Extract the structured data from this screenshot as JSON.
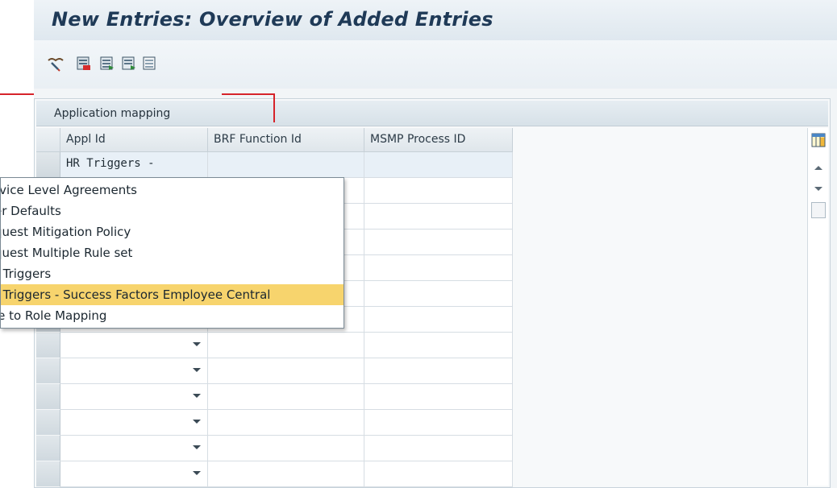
{
  "title": "New Entries: Overview of Added Entries",
  "toolbar": {
    "icons": [
      "edit-glasses-icon",
      "save-variant-icon",
      "select-all-icon",
      "select-block-icon",
      "deselect-all-icon"
    ]
  },
  "panel": {
    "title": "Application mapping"
  },
  "table": {
    "columns": [
      "Appl Id",
      "BRF Function Id",
      "MSMP Process ID"
    ],
    "first_row": {
      "appl_id_value": "HR Triggers -",
      "brf_function_id": "",
      "msmp_process_id": ""
    }
  },
  "dropdown": {
    "items": [
      "rvice Level Agreements",
      "er Defaults",
      "quest Mitigation Policy",
      "quest Multiple Rule set",
      "( Triggers",
      "( Triggers - Success Factors Employee Central",
      "le to Role Mapping"
    ],
    "highlighted_index": 5
  },
  "colors": {
    "highlight": "#f7d46d",
    "annotation_red": "#d6232a",
    "title_text": "#1f3a57"
  }
}
